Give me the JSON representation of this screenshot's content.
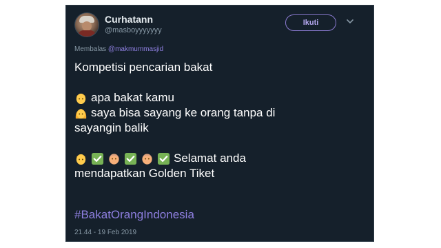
{
  "tweet": {
    "display_name": "Curhatann",
    "username": "@masboyyyyyyy",
    "follow_label": "Ikuti",
    "reply_prefix": "Membalas",
    "reply_to": "@makmummasjid",
    "lines": {
      "l1": "Kompetisi pencarian bakat",
      "l2": "apa bakat kamu",
      "l3": "saya bisa sayang ke orang tanpa di",
      "l4": "sayangin balik",
      "l5": "Selamat anda",
      "l6": "mendapatkan Golden Tiket"
    },
    "hashtag": "#BakatOrangIndonesia",
    "timestamp": "21.44 - 19 Feb 2019"
  },
  "icons": {
    "avatar": "user-avatar",
    "chevron": "chevron-down-icon",
    "emoji_man": "blond-man-emoji",
    "emoji_woman": "blond-woman-emoji",
    "emoji_check": "check-mark-emoji",
    "emoji_older_man": "older-man-emoji"
  },
  "colors": {
    "background": "#15202b",
    "accent": "#8e7fe0",
    "muted": "#8899a6",
    "check_green": "#77b255"
  }
}
